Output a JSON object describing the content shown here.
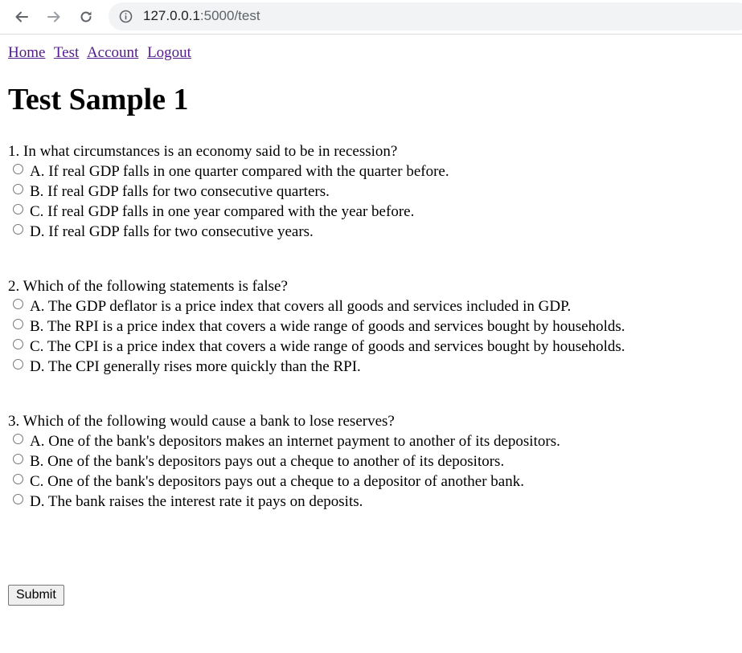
{
  "browser": {
    "url_host": "127.0.0.1",
    "url_path": ":5000/test",
    "back_icon": "arrow-left-icon",
    "forward_icon": "arrow-right-icon",
    "reload_icon": "reload-icon",
    "info_icon": "info-icon"
  },
  "nav": {
    "links": [
      "Home",
      "Test",
      "Account",
      "Logout"
    ],
    "link_color": "#551a8b"
  },
  "page": {
    "title": "Test Sample 1"
  },
  "questions": [
    {
      "text": "1. In what circumstances is an economy said to be in recession?",
      "options": [
        "A. If real GDP falls in one quarter compared with the quarter before.",
        "B. If real GDP falls for two consecutive quarters.",
        "C. If real GDP falls in one year compared with the year before.",
        "D. If real GDP falls for two consecutive years."
      ]
    },
    {
      "text": "2. Which of the following statements is false?",
      "options": [
        "A. The GDP deflator is a price index that covers all goods and services included in GDP.",
        "B. The RPI is a price index that covers a wide range of goods and services bought by households.",
        "C. The CPI is a price index that covers a wide range of goods and services bought by households.",
        "D. The CPI generally rises more quickly than the RPI."
      ]
    },
    {
      "text": "3. Which of the following would cause a bank to lose reserves?",
      "options": [
        "A. One of the bank's depositors makes an internet payment to another of its depositors.",
        "B. One of the bank's depositors pays out a cheque to another of its depositors.",
        "C. One of the bank's depositors pays out a cheque to a depositor of another bank.",
        "D. The bank raises the interest rate it pays on deposits."
      ]
    }
  ],
  "form": {
    "submit_label": "Submit"
  }
}
